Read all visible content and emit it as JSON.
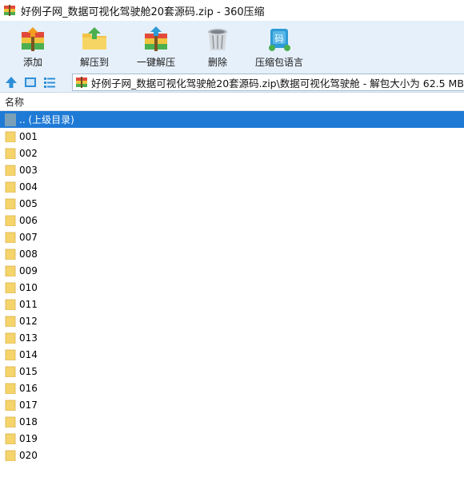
{
  "window": {
    "title": "好例子网_数据可视化驾驶舱20套源码.zip - 360压缩"
  },
  "toolbar": {
    "buttons": [
      {
        "label": "添加",
        "icon": "add-archive-icon"
      },
      {
        "label": "解压到",
        "icon": "extract-to-icon"
      },
      {
        "label": "一键解压",
        "icon": "one-click-extract-icon"
      },
      {
        "label": "删除",
        "icon": "trash-icon"
      },
      {
        "label": "压缩包语言",
        "icon": "archive-language-icon"
      }
    ]
  },
  "nav": {
    "path": "好例子网_数据可视化驾驶舱20套源码.zip\\数据可视化驾驶舱 - 解包大小为 62.5 MB"
  },
  "columns": {
    "name": "名称"
  },
  "files": {
    "parent": ".. (上级目录)",
    "items": [
      "001",
      "002",
      "003",
      "004",
      "005",
      "006",
      "007",
      "008",
      "009",
      "010",
      "011",
      "012",
      "013",
      "014",
      "015",
      "016",
      "017",
      "018",
      "019",
      "020"
    ]
  },
  "colors": {
    "toolbar_bg": "#e6f0fa",
    "selection": "#1f7ad6",
    "folder": "#f5d46b"
  }
}
